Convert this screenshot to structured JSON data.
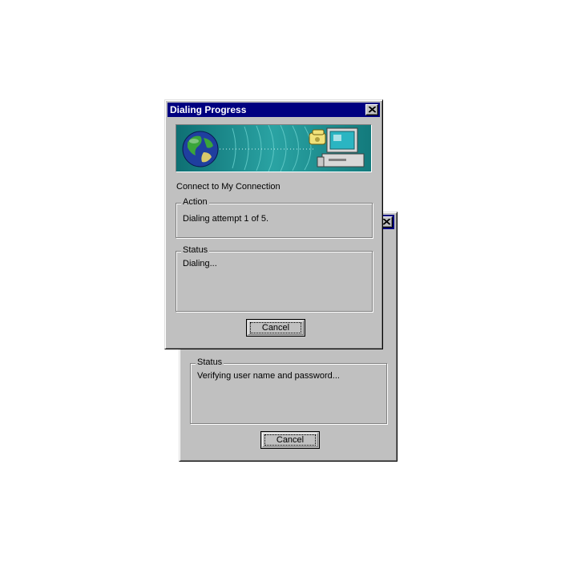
{
  "back_dialog": {
    "status_label": "Status",
    "status_text": "Verifying user name and password...",
    "cancel_label": "Cancel"
  },
  "front_dialog": {
    "title": "Dialing Progress",
    "connect_text": "Connect to My Connection",
    "action_label": "Action",
    "action_text": "Dialing attempt 1 of 5.",
    "status_label": "Status",
    "status_text": "Dialing...",
    "cancel_label": "Cancel"
  },
  "colors": {
    "titlebar": "#000080",
    "window_face": "#c0c0c0",
    "banner_teal": "#1a8a8a"
  },
  "icons": [
    "close-icon",
    "globe-icon",
    "phone-icon",
    "computer-icon"
  ]
}
